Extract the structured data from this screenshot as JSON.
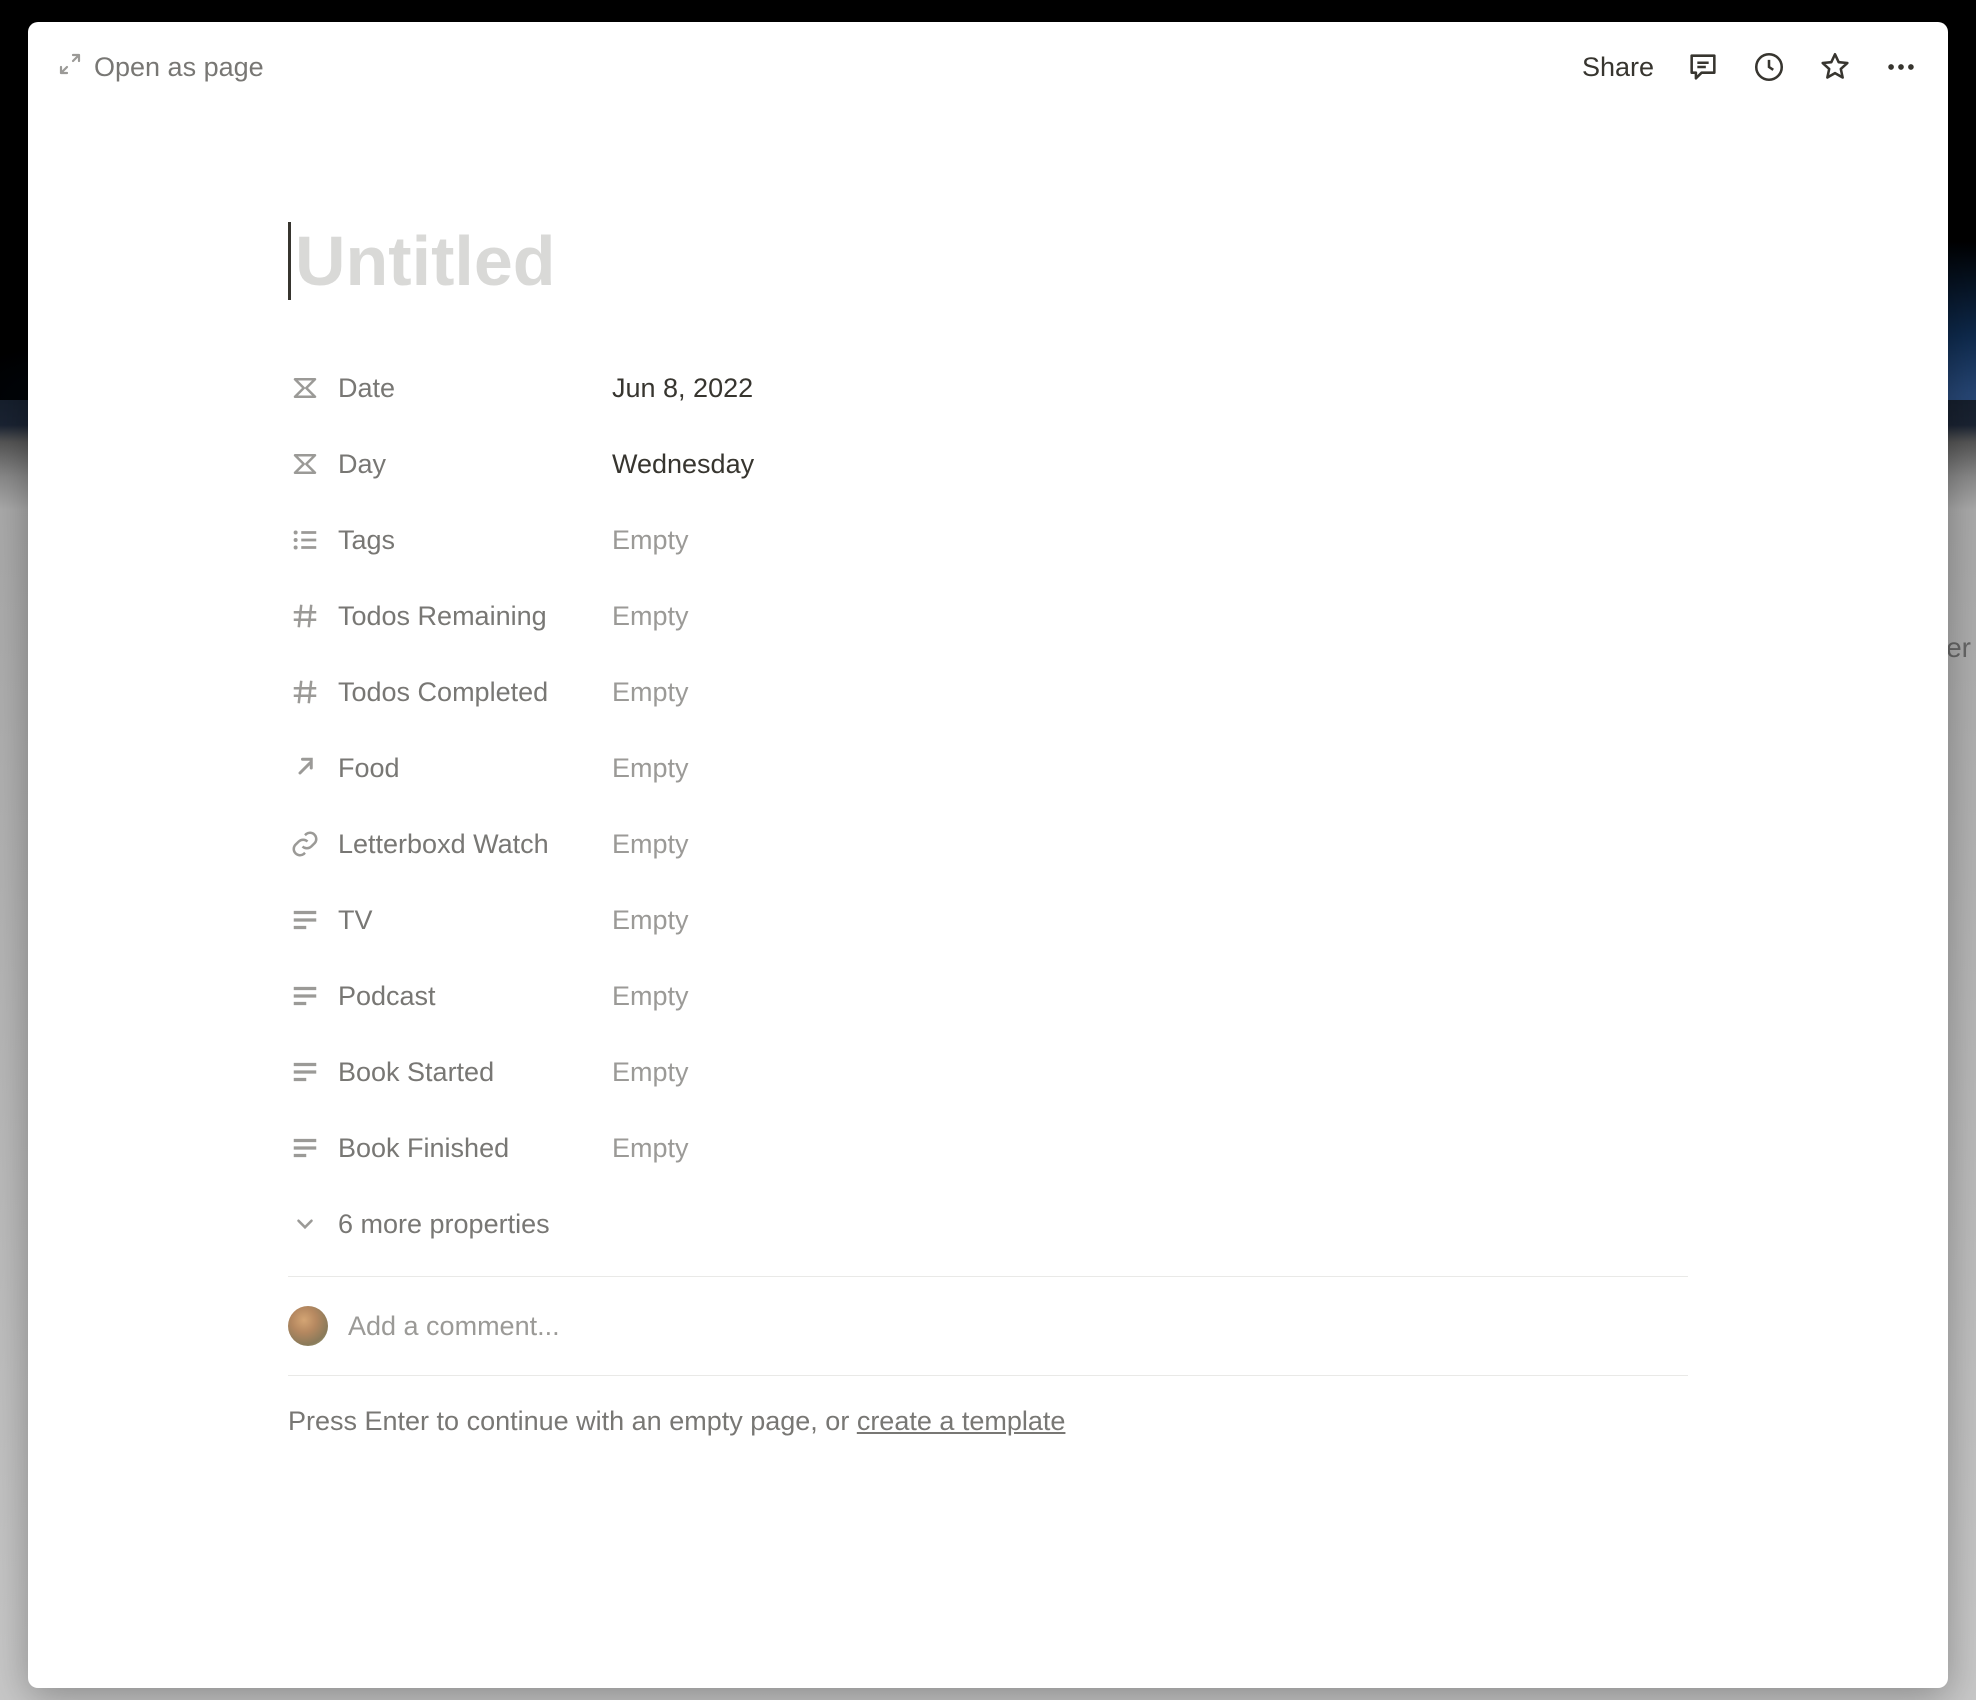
{
  "backdrop": {
    "right_label": "er"
  },
  "topbar": {
    "open_as_page": "Open as page",
    "share": "Share"
  },
  "title": {
    "placeholder": "Untitled"
  },
  "properties": [
    {
      "icon": "formula",
      "label": "Date",
      "value": "Jun 8, 2022",
      "empty": false
    },
    {
      "icon": "formula",
      "label": "Day",
      "value": "Wednesday",
      "empty": false
    },
    {
      "icon": "multiselect",
      "label": "Tags",
      "value": "Empty",
      "empty": true
    },
    {
      "icon": "number",
      "label": "Todos Remaining",
      "value": "Empty",
      "empty": true
    },
    {
      "icon": "number",
      "label": "Todos Completed",
      "value": "Empty",
      "empty": true
    },
    {
      "icon": "relation",
      "label": "Food",
      "value": "Empty",
      "empty": true
    },
    {
      "icon": "url",
      "label": "Letterboxd Watch",
      "value": "Empty",
      "empty": true
    },
    {
      "icon": "text",
      "label": "TV",
      "value": "Empty",
      "empty": true
    },
    {
      "icon": "text",
      "label": "Podcast",
      "value": "Empty",
      "empty": true
    },
    {
      "icon": "text",
      "label": "Book Started",
      "value": "Empty",
      "empty": true
    },
    {
      "icon": "text",
      "label": "Book Finished",
      "value": "Empty",
      "empty": true
    }
  ],
  "empty_label": "Empty",
  "more_properties": "6 more properties",
  "comment": {
    "placeholder": "Add a comment..."
  },
  "body_hint": {
    "prefix": "Press Enter to continue with an empty page, or ",
    "link": "create a template"
  }
}
